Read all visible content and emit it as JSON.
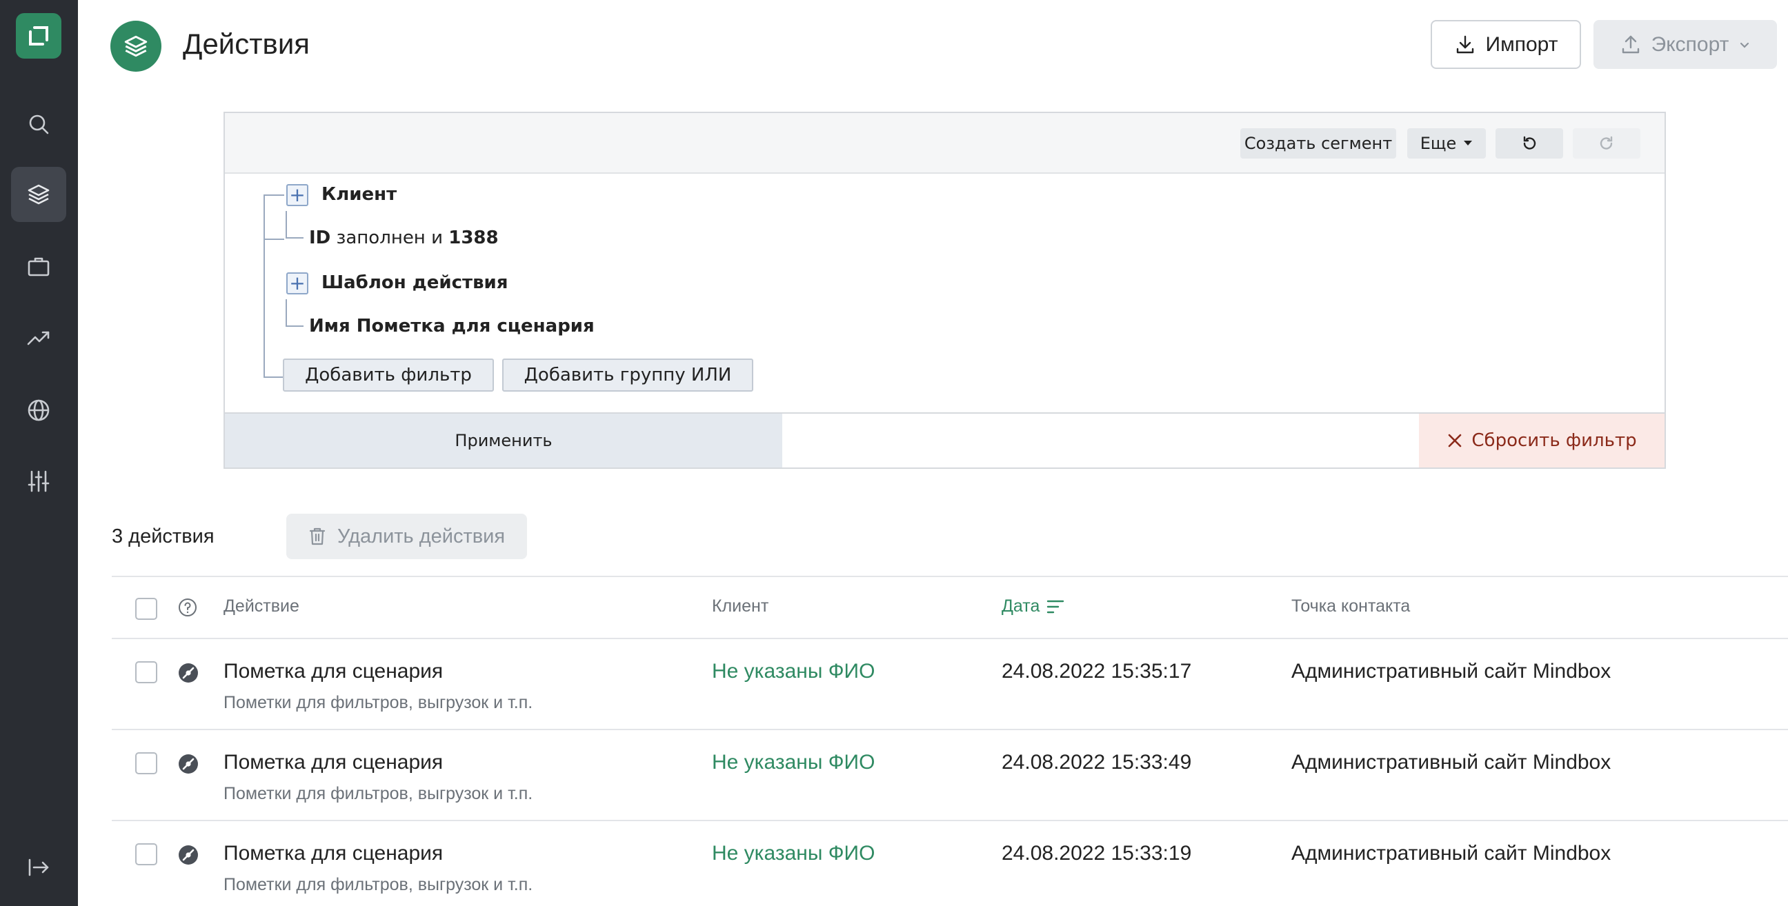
{
  "sidebar": {
    "items": [
      "logo",
      "search",
      "actions",
      "briefcase",
      "analytics",
      "globe",
      "settings",
      "logout"
    ]
  },
  "header": {
    "title": "Действия",
    "import_label": "Импорт",
    "export_label": "Экспорт"
  },
  "filter": {
    "toolbar": {
      "create_segment": "Создать сегмент",
      "more": "Еще"
    },
    "tree": {
      "group1_title": "Клиент",
      "condition1_field": "ID",
      "condition1_op": "заполнен и",
      "condition1_value": "1388",
      "group2_title": "Шаблон действия",
      "condition2_text": "Имя Пометка для сценария"
    },
    "add_filter": "Добавить фильтр",
    "add_or_group": "Добавить группу ИЛИ",
    "apply": "Применить",
    "reset": "Сбросить фильтр"
  },
  "list": {
    "count": "3 действия",
    "delete_label": "Удалить действия"
  },
  "table": {
    "columns": {
      "action": "Действие",
      "client": "Клиент",
      "date": "Дата",
      "contact_point": "Точка контакта"
    },
    "rows": [
      {
        "title": "Пометка для сценария",
        "subtitle": "Пометки для фильтров, выгрузок и т.п.",
        "client": "Не указаны ФИО",
        "date": "24.08.2022 15:35:17",
        "contact_point": "Административный сайт Mindbox"
      },
      {
        "title": "Пометка для сценария",
        "subtitle": "Пометки для фильтров, выгрузок и т.п.",
        "client": "Не указаны ФИО",
        "date": "24.08.2022 15:33:49",
        "contact_point": "Административный сайт Mindbox"
      },
      {
        "title": "Пометка для сценария",
        "subtitle": "Пометки для фильтров, выгрузок и т.п.",
        "client": "Не указаны ФИО",
        "date": "24.08.2022 15:33:19",
        "contact_point": "Административный сайт Mindbox"
      }
    ]
  },
  "colors": {
    "brand_green": "#2f8a62",
    "sidebar_bg": "#2a2d33",
    "reset_red": "#8b2a1a"
  }
}
